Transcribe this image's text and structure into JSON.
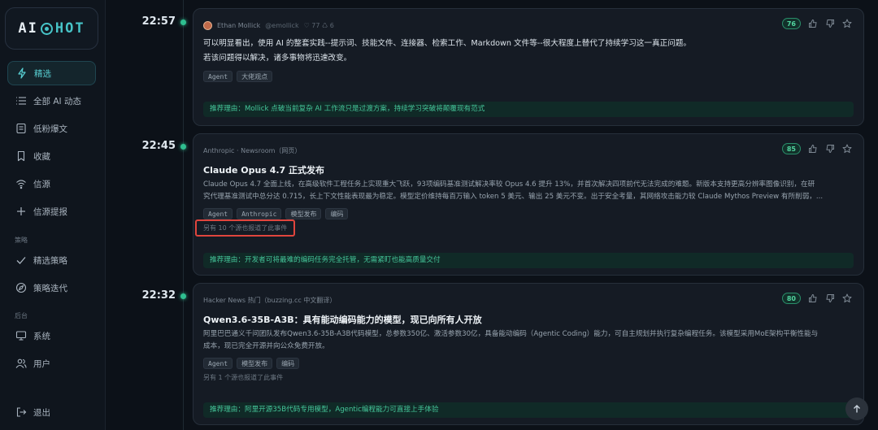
{
  "brand": {
    "ai": "AI",
    "hot": "HOT"
  },
  "sidebar": {
    "items": [
      {
        "label": "精选",
        "icon": "lightning-icon",
        "active": true
      },
      {
        "label": "全部 AI 动态",
        "icon": "list-icon"
      },
      {
        "label": "低粉爆文",
        "icon": "document-icon"
      },
      {
        "label": "收藏",
        "icon": "bookmark-icon"
      },
      {
        "label": "信源",
        "icon": "wifi-icon"
      },
      {
        "label": "信源提报",
        "icon": "plus-icon"
      }
    ],
    "section_strategy": "策略",
    "strategy_items": [
      {
        "label": "精选策略",
        "icon": "check-icon"
      },
      {
        "label": "策略迭代",
        "icon": "compass-icon"
      }
    ],
    "section_backend": "后台",
    "backend_items": [
      {
        "label": "系统",
        "icon": "monitor-icon"
      },
      {
        "label": "用户",
        "icon": "users-icon"
      }
    ],
    "logout": {
      "label": "退出",
      "icon": "logout-icon"
    }
  },
  "feed": [
    {
      "time": "22:57",
      "source_name": "Ethan Mollick",
      "source_handle": "@emollick",
      "source_stats": "♡ 77 ♺ 6",
      "score": "76",
      "body_line1": "可以明显看出，使用 AI 的整套实践--提示词、技能文件、连接器、检索工作、Markdown 文件等--很大程度上替代了持续学习这一真正问题。",
      "body_line2": "若该问题得以解决，诸多事物将迅速改变。",
      "tags": [
        "Agent",
        "大佬观点"
      ],
      "reason": "推荐理由：Mollick 点破当前复杂 AI 工作流只是过渡方案，持续学习突破将颠覆现有范式"
    },
    {
      "time": "22:45",
      "source": "Anthropic · Newsroom（网页）",
      "score": "85",
      "title": "Claude Opus 4.7 正式发布",
      "body_line1": "Claude Opus 4.7 全面上线，在高级软件工程任务上实现重大飞跃，93项编码基准测试解决率较 Opus 4.6 提升 13%，并首次解决四项前代无法完成的难题。新版本支持更高分辨率图像识别，在研",
      "body_line2": "究代理基准测试中总分达 0.715，长上下文性能表现最为稳定。模型定价维持每百万输入 token 5 美元、输出 25 美元不变。出于安全考量，其网络攻击能力较 Claude Mythos Preview 有所削弱，...",
      "tags": [
        "Agent",
        "Anthropic",
        "模型发布",
        "编码"
      ],
      "also": "另有 10 个源也报道了此事件",
      "reason": "推荐理由：开发者可将最难的编码任务完全托管，无需紧盯也能高质量交付"
    },
    {
      "time": "22:32",
      "source": "Hacker News 热门（buzzing.cc 中文翻译）",
      "score": "80",
      "title": "Qwen3.6-35B-A3B：具有能动编码能力的模型，现已向所有人开放",
      "body_line1": "阿里巴巴通义千问团队发布Qwen3.6-35B-A3B代码模型，总参数350亿、激活参数30亿，具备能动编码（Agentic Coding）能力，可自主规划并执行复杂编程任务。该模型采用MoE架构平衡性能与",
      "body_line2": "成本，现已完全开源并向公众免费开放。",
      "tags": [
        "Agent",
        "模型发布",
        "编码"
      ],
      "also": "另有 1 个源也报道了此事件",
      "reason": "推荐理由：阿里开源35B代码专用模型，Agentic编程能力可直接上手体验"
    }
  ]
}
